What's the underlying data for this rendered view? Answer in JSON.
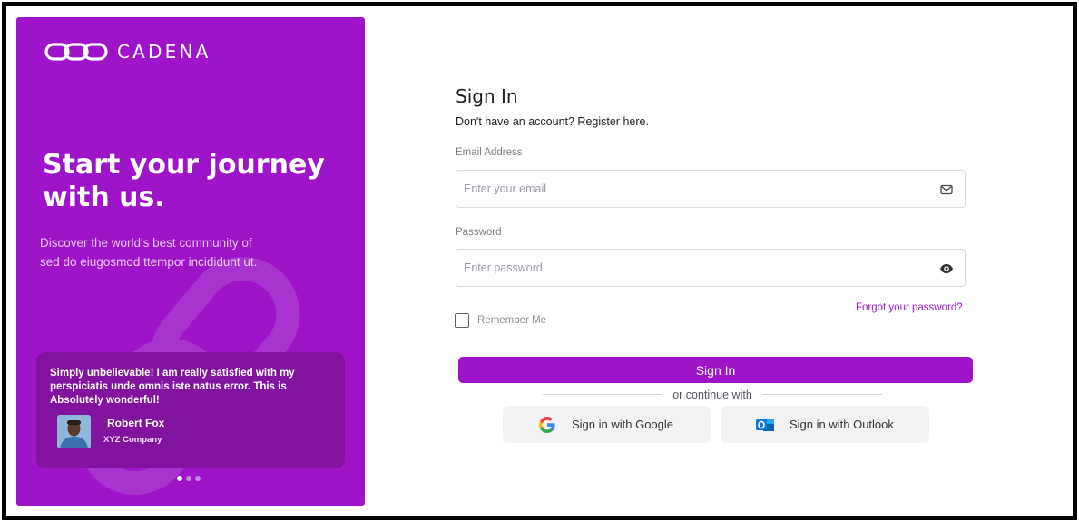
{
  "promo": {
    "brand_name": "CADENA",
    "hero_title": "Start your journey with us.",
    "hero_description": "Discover the world's best community of sed do eiugosmod ttempor incididunt ut.",
    "testimonial": {
      "quote": "Simply unbelievable! I am really satisfied with my perspiciatis unde omnis iste natus error. This is Absolutely wonderful!",
      "name": "Robert Fox",
      "company": "XYZ Company"
    },
    "carousel_dots": 3,
    "carousel_active": 1
  },
  "form": {
    "title": "Sign In",
    "register_text": "Don't have an account? Register here.",
    "email": {
      "label": "Email Address",
      "placeholder": "Enter your email",
      "value": ""
    },
    "password": {
      "label": "Password",
      "placeholder": "Enter password",
      "value": ""
    },
    "remember_label": "Remember Me",
    "remember_checked": false,
    "forgot_label": "Forgot your password?",
    "submit_label": "Sign In",
    "divider_text": "or continue with",
    "google_label": "Sign in with Google",
    "outlook_label": "Sign in with Outlook"
  },
  "colors": {
    "accent": "#9d14c9",
    "testimonial_bg": "#82139f",
    "social_bg": "#f3f3f5"
  },
  "icons": {
    "brand": "chain-link-logo",
    "email": "mail-icon",
    "password": "eye-icon",
    "google": "google-icon",
    "outlook": "outlook-icon"
  }
}
